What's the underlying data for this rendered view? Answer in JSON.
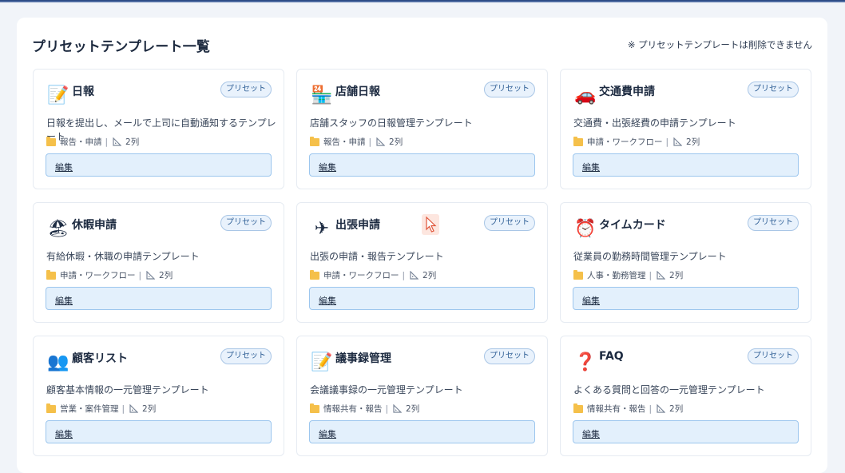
{
  "page": {
    "title": "プリセットテンプレート一覧",
    "note": "※ プリセットテンプレートは削除できません"
  },
  "templates": [
    {
      "title": "日報",
      "icon": "memo-icon",
      "emoji": "📝",
      "badge": "プリセット",
      "description": "日報を提出し、メールで上司に自動通知するテンプレート",
      "category": "報告・申請",
      "columns": "2列",
      "edit_label": "編集"
    },
    {
      "title": "店舗日報",
      "icon": "convenience-store-icon",
      "emoji": "🏪",
      "badge": "プリセット",
      "description": "店舗スタッフの日報管理テンプレート",
      "category": "報告・申請",
      "columns": "2列",
      "edit_label": "編集"
    },
    {
      "title": "交通費申請",
      "icon": "car-icon",
      "emoji": "🚗",
      "badge": "プリセット",
      "description": "交通費・出張経費の申請テンプレート",
      "category": "申請・ワークフロー",
      "columns": "2列",
      "edit_label": "編集"
    },
    {
      "title": "休暇申請",
      "icon": "beach-umbrella-icon",
      "emoji": "🏖",
      "badge": "プリセット",
      "description": "有給休暇・休職の申請テンプレート",
      "category": "申請・ワークフロー",
      "columns": "2列",
      "edit_label": "編集"
    },
    {
      "title": "出張申請",
      "icon": "airplane-icon",
      "emoji": "✈",
      "badge": "プリセット",
      "description": "出張の申請・報告テンプレート",
      "category": "申請・ワークフロー",
      "columns": "2列",
      "edit_label": "編集"
    },
    {
      "title": "タイムカード",
      "icon": "alarm-clock-icon",
      "emoji": "⏰",
      "badge": "プリセット",
      "description": "従業員の勤務時間管理テンプレート",
      "category": "人事・勤務管理",
      "columns": "2列",
      "edit_label": "編集"
    },
    {
      "title": "顧客リスト",
      "icon": "users-icon",
      "emoji": "👥",
      "badge": "プリセット",
      "description": "顧客基本情報の一元管理テンプレート",
      "category": "営業・案件管理",
      "columns": "2列",
      "edit_label": "編集"
    },
    {
      "title": "議事録管理",
      "icon": "memo-icon",
      "emoji": "📝",
      "badge": "プリセット",
      "description": "会議議事録の一元管理テンプレート",
      "category": "情報共有・報告",
      "columns": "2列",
      "edit_label": "編集"
    },
    {
      "title": "FAQ",
      "icon": "question-mark-icon",
      "emoji": "❓",
      "badge": "プリセット",
      "description": "よくある質問と回答の一元管理テンプレート",
      "category": "情報共有・報告",
      "columns": "2列",
      "edit_label": "編集"
    }
  ]
}
